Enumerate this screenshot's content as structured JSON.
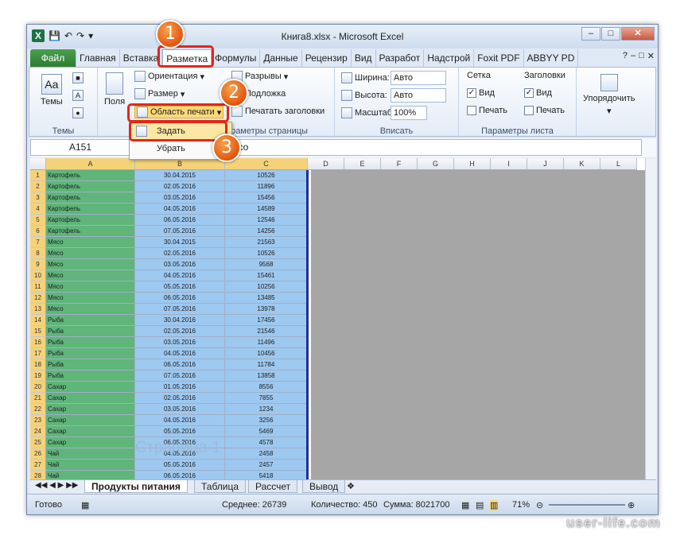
{
  "window": {
    "title": "Книга8.xlsx  -  Microsoft Excel"
  },
  "tabs": [
    "Файл",
    "Главная",
    "Вставка",
    "Разметка",
    "Формулы",
    "Данные",
    "Рецензир",
    "Вид",
    "Разработ",
    "Надстрой",
    "Foxit PDF",
    "ABBYY PD"
  ],
  "active_tab": "Разметка",
  "ribbon": {
    "themes": {
      "button": "Темы",
      "label": "Темы"
    },
    "page_setup": {
      "fields": "Поля",
      "orientation": "Ориентация",
      "size": "Размер",
      "print_area": "Область печати",
      "breaks": "Разрывы",
      "background": "Подложка",
      "print_titles": "Печатать заголовки",
      "label": "Параметры страницы"
    },
    "fit": {
      "width_label": "Ширина:",
      "width_value": "Авто",
      "height_label": "Высота:",
      "height_value": "Авто",
      "scale_label": "Масштаб:",
      "scale_value": "100%",
      "label": "Вписать"
    },
    "sheet_options": {
      "grid": "Сетка",
      "headings": "Заголовки",
      "view": "Вид",
      "print": "Печать",
      "label": "Параметры листа"
    },
    "arrange": {
      "button": "Упорядочить"
    }
  },
  "dropdown": {
    "set": "Задать",
    "remove": "Убрать"
  },
  "formula_bar": {
    "name_box": "A151",
    "formula": "Мясо"
  },
  "columns": [
    "A",
    "B",
    "C",
    "D",
    "E",
    "F",
    "G",
    "H",
    "I",
    "J",
    "K",
    "L"
  ],
  "rows": [
    {
      "n": "1",
      "a": "Картофель",
      "b": "30.04.2015",
      "c": "10526"
    },
    {
      "n": "2",
      "a": "Картофель",
      "b": "02.05.2016",
      "c": "11896"
    },
    {
      "n": "3",
      "a": "Картофель",
      "b": "03.05.2016",
      "c": "15456"
    },
    {
      "n": "4",
      "a": "Картофель",
      "b": "04.05.2016",
      "c": "14589"
    },
    {
      "n": "5",
      "a": "Картофель",
      "b": "06.05.2016",
      "c": "12546"
    },
    {
      "n": "6",
      "a": "Картофель",
      "b": "07.05.2016",
      "c": "14256"
    },
    {
      "n": "7",
      "a": "Мясо",
      "b": "30.04.2015",
      "c": "21563"
    },
    {
      "n": "8",
      "a": "Мясо",
      "b": "02.05.2016",
      "c": "10526"
    },
    {
      "n": "9",
      "a": "Мясо",
      "b": "03.05.2016",
      "c": "9568"
    },
    {
      "n": "10",
      "a": "Мясо",
      "b": "04.05.2016",
      "c": "15461"
    },
    {
      "n": "11",
      "a": "Мясо",
      "b": "05.05.2016",
      "c": "10256"
    },
    {
      "n": "12",
      "a": "Мясо",
      "b": "06.05.2016",
      "c": "13485"
    },
    {
      "n": "13",
      "a": "Мясо",
      "b": "07.05.2016",
      "c": "13978"
    },
    {
      "n": "14",
      "a": "Рыба",
      "b": "30.04.2016",
      "c": "17456"
    },
    {
      "n": "15",
      "a": "Рыба",
      "b": "02.05.2016",
      "c": "21546"
    },
    {
      "n": "16",
      "a": "Рыба",
      "b": "03.05.2016",
      "c": "11496"
    },
    {
      "n": "17",
      "a": "Рыба",
      "b": "04.05.2016",
      "c": "10456"
    },
    {
      "n": "18",
      "a": "Рыба",
      "b": "06.05.2016",
      "c": "11784"
    },
    {
      "n": "19",
      "a": "Рыба",
      "b": "07.05.2016",
      "c": "13858"
    },
    {
      "n": "20",
      "a": "Сахар",
      "b": "01.05.2016",
      "c": "8556"
    },
    {
      "n": "21",
      "a": "Сахар",
      "b": "02.05.2016",
      "c": "7855"
    },
    {
      "n": "22",
      "a": "Сахар",
      "b": "03.05.2016",
      "c": "1234"
    },
    {
      "n": "23",
      "a": "Сахар",
      "b": "04.05.2016",
      "c": "3256"
    },
    {
      "n": "24",
      "a": "Сахар",
      "b": "05.05.2016",
      "c": "5469"
    },
    {
      "n": "25",
      "a": "Сахар",
      "b": "06.05.2016",
      "c": "4578"
    },
    {
      "n": "26",
      "a": "Чай",
      "b": "04.05.2016",
      "c": "2458"
    },
    {
      "n": "27",
      "a": "Чай",
      "b": "05.05.2016",
      "c": "2457"
    },
    {
      "n": "28",
      "a": "Чай",
      "b": "06.05.2016",
      "c": "5418"
    }
  ],
  "page_watermark": "Страница 1",
  "sheets": [
    "Продукты питания",
    "Таблица",
    "Рассчет",
    "Вывод"
  ],
  "active_sheet": "Продукты питания",
  "status": {
    "ready": "Готово",
    "average": "Среднее: 26739",
    "count": "Количество: 450",
    "sum": "Сумма: 8021700",
    "zoom": "71%"
  },
  "markers": [
    "1",
    "2",
    "3"
  ],
  "site": "user-life.com",
  "colors": {
    "col_a": "#5fb57a",
    "col_b": "#9dc8f0",
    "col_c": "#9dc8f0",
    "row_header_selected": "#f5d27a",
    "highlight": "#e4261a",
    "marker": "#e2560f"
  }
}
